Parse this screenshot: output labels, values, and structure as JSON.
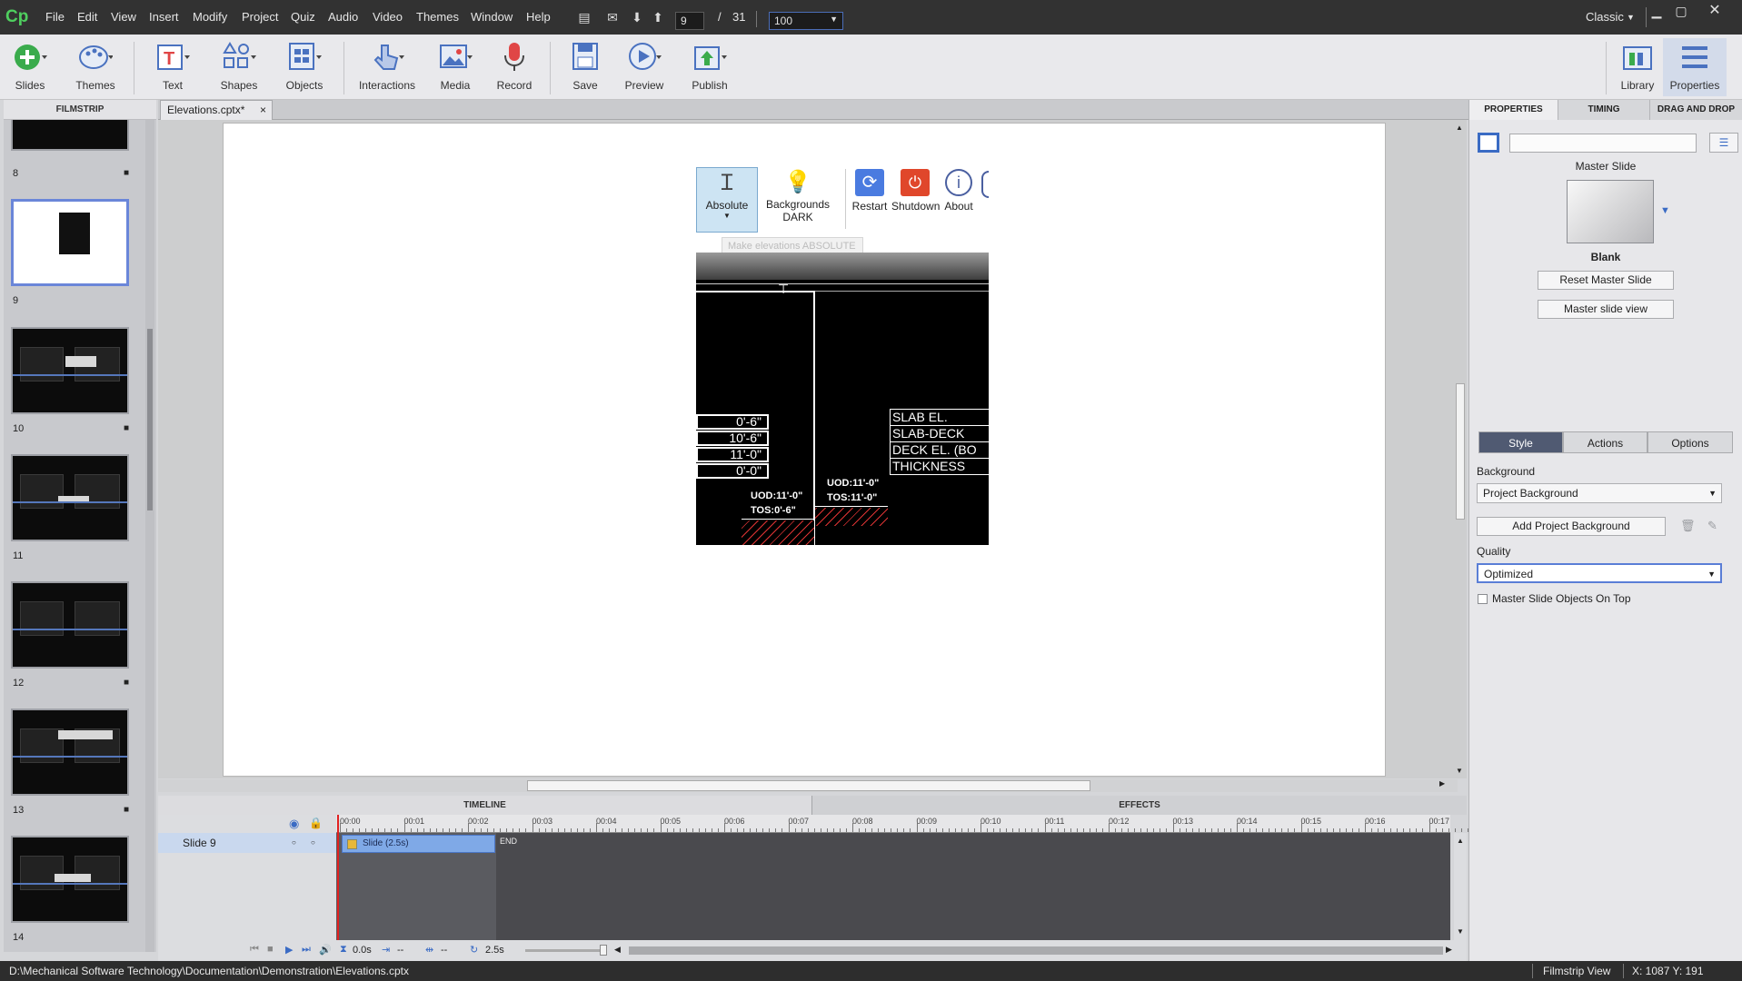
{
  "app": {
    "logo": "Cp"
  },
  "menu": [
    "File",
    "Edit",
    "View",
    "Insert",
    "Modify",
    "Project",
    "Quiz",
    "Audio",
    "Video",
    "Themes",
    "Window",
    "Help"
  ],
  "nav": {
    "current_slide": "9",
    "separator": "/",
    "total_slides": "31",
    "zoom": "100"
  },
  "workspace": {
    "mode": "Classic"
  },
  "toolbar": {
    "slides": "Slides",
    "themes": "Themes",
    "text": "Text",
    "shapes": "Shapes",
    "objects": "Objects",
    "interactions": "Interactions",
    "media": "Media",
    "record": "Record",
    "save": "Save",
    "preview": "Preview",
    "publish": "Publish",
    "library": "Library",
    "properties": "Properties"
  },
  "filmstrip": {
    "header": "FILMSTRIP",
    "slides": [
      {
        "num": "8"
      },
      {
        "num": "9"
      },
      {
        "num": "10"
      },
      {
        "num": "11"
      },
      {
        "num": "12"
      },
      {
        "num": "13"
      },
      {
        "num": "14"
      }
    ]
  },
  "document": {
    "tab": "Elevations.cptx*",
    "close": "×"
  },
  "slide_content": {
    "ribbon": {
      "absolute": "Absolute",
      "backgrounds": "Backgrounds",
      "dark": "DARK",
      "restart": "Restart",
      "shutdown": "Shutdown",
      "about": "About"
    },
    "tooltip": "Make elevations ABSOLUTE",
    "dims": [
      "0'-6\"",
      "10'-6\"",
      "11'-0\"",
      "0'-0\""
    ],
    "labels": [
      "SLAB EL.",
      "SLAB-DECK",
      "DECK EL. (BO",
      "THICKNESS"
    ],
    "uod_left": "UOD:11'-0\"",
    "tos_left": "TOS:0'-6\"",
    "uod_right": "UOD:11'-0\"",
    "tos_right": "TOS:11'-0\""
  },
  "timeline": {
    "header_timeline": "TIMELINE",
    "header_effects": "EFFECTS",
    "row_label": "Slide 9",
    "bar_label": "Slide (2.5s)",
    "end_label": "END",
    "ticks": [
      "00:00",
      "00:01",
      "00:02",
      "00:03",
      "00:04",
      "00:05",
      "00:06",
      "00:07",
      "00:08",
      "00:09",
      "00:10",
      "00:11",
      "00:12",
      "00:13",
      "00:14",
      "00:15",
      "00:16",
      "00:17"
    ],
    "current_time": "0.0s",
    "in_time": "--",
    "out_time": "--",
    "duration": "2.5s"
  },
  "properties": {
    "tabs": [
      "PROPERTIES",
      "TIMING",
      "DRAG AND DROP"
    ],
    "master_slide_label": "Master Slide",
    "master_name": "Blank",
    "reset_master": "Reset Master Slide",
    "master_view": "Master slide view",
    "segments": [
      "Style",
      "Actions",
      "Options"
    ],
    "background_label": "Background",
    "background_value": "Project Background",
    "add_background": "Add Project Background",
    "quality_label": "Quality",
    "quality_value": "Optimized",
    "master_on_top": "Master Slide Objects On Top",
    "master_on_top_checked": false
  },
  "statusbar": {
    "path": "D:\\Mechanical Software Technology\\Documentation\\Demonstration\\Elevations.cptx",
    "view": "Filmstrip View",
    "coords": "X: 1087 Y: 191"
  },
  "colors": {
    "accent": "#5a7ed6",
    "logo_green": "#4fcf5f",
    "record_red": "#e04646",
    "playhead": "#e02121"
  }
}
